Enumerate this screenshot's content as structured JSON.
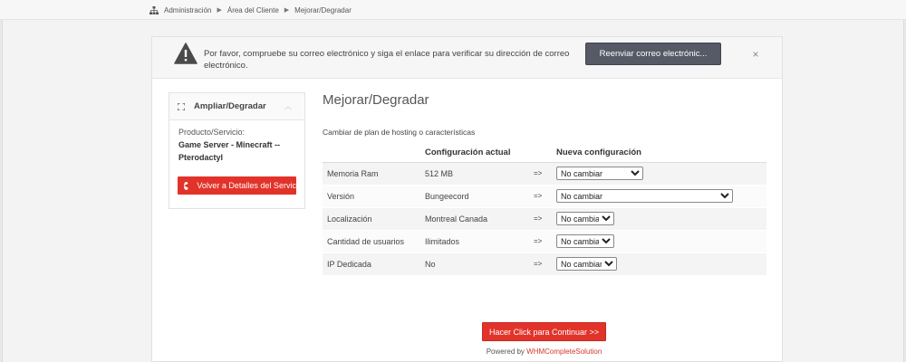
{
  "breadcrumb": {
    "items": [
      "Administración",
      "Área del Cliente",
      "Mejorar/Degradar"
    ],
    "separator": "▶"
  },
  "alert": {
    "icon": "warning-icon",
    "message": "Por favor, compruebe su correo electrónico y siga el enlace para verificar su dirección de correo electrónico.",
    "button_label": "Reenviar correo electrónic...",
    "close_label": "×"
  },
  "sidebar": {
    "title": "Ampliar/Degradar",
    "expand_icon": "expand-icon",
    "chevron_icon": "chevron-up-icon",
    "chevron_glyph": "︿",
    "product_label": "Producto/Servicio:",
    "product_name": "Game Server - Minecraft -- Pterodactyl",
    "back_button_label": "Volver a Detalles del Servicio",
    "back_icon": "arrow-left-circle-icon",
    "back_icon_glyph": "◀"
  },
  "main": {
    "title": "Mejorar/Degradar",
    "subtitle": "Cambiar de plan de hosting o características",
    "columns": {
      "option": "",
      "current": "Configuración actual",
      "arrow": "",
      "new": "Nueva configuración"
    },
    "arrow_text": "=>",
    "rows": [
      {
        "option": "Memoria Ram",
        "current": "512 MB",
        "select": "No cambiar"
      },
      {
        "option": "Versión",
        "current": "Bungeecord",
        "select": "No cambiar"
      },
      {
        "option": "Localización",
        "current": "Montreal Canada",
        "select": "No cambiar"
      },
      {
        "option": "Cantidad de usuarios",
        "current": "Ilimitados",
        "select": "No cambiar"
      },
      {
        "option": "IP Dedicada",
        "current": "No",
        "select": "No cambiar"
      }
    ],
    "submit_label": "Hacer Click para Continuar >>",
    "powered_prefix": "Powered by ",
    "powered_link": "WHMCompleteSolution"
  },
  "colors": {
    "accent_red": "#e2332a",
    "alert_button": "#565a66",
    "link_red": "#d4372c"
  }
}
